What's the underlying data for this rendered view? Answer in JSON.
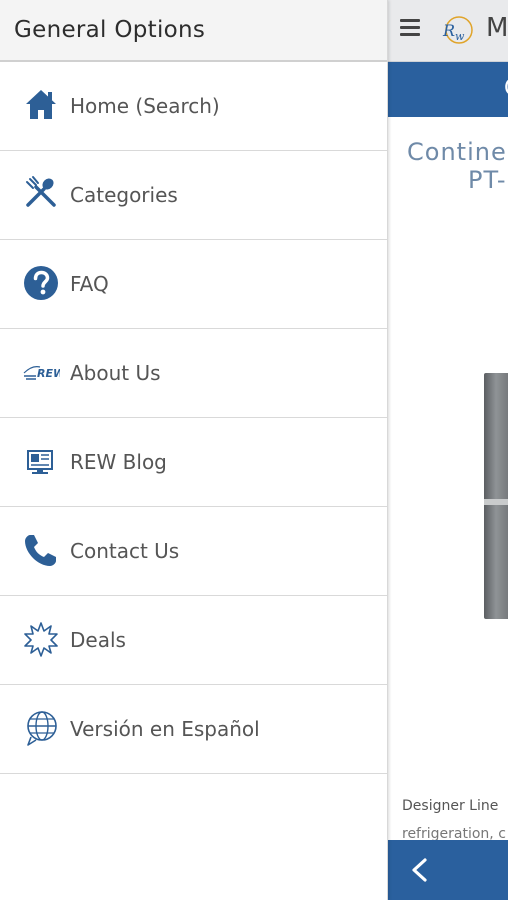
{
  "drawer": {
    "title": "General Options",
    "items": [
      {
        "label": "Home (Search)",
        "icon": "home-icon"
      },
      {
        "label": "Categories",
        "icon": "utensils-icon"
      },
      {
        "label": "FAQ",
        "icon": "question-icon"
      },
      {
        "label": "About Us",
        "icon": "rew-logo-icon"
      },
      {
        "label": "REW Blog",
        "icon": "blog-icon"
      },
      {
        "label": "Contact Us",
        "icon": "phone-icon"
      },
      {
        "label": "Deals",
        "icon": "burst-icon"
      },
      {
        "label": "Versión en Español",
        "icon": "globe-chat-icon"
      }
    ]
  },
  "background_page": {
    "title_partial": "M",
    "band_partial": "C",
    "heading_line1": "Contine",
    "heading_line2": "PT-",
    "description_line1": "Designer Line",
    "description_line2": "refrigeration, c"
  },
  "colors": {
    "accent": "#2a609e",
    "icon": "#2d5f96",
    "heading": "#6f8aa8"
  }
}
